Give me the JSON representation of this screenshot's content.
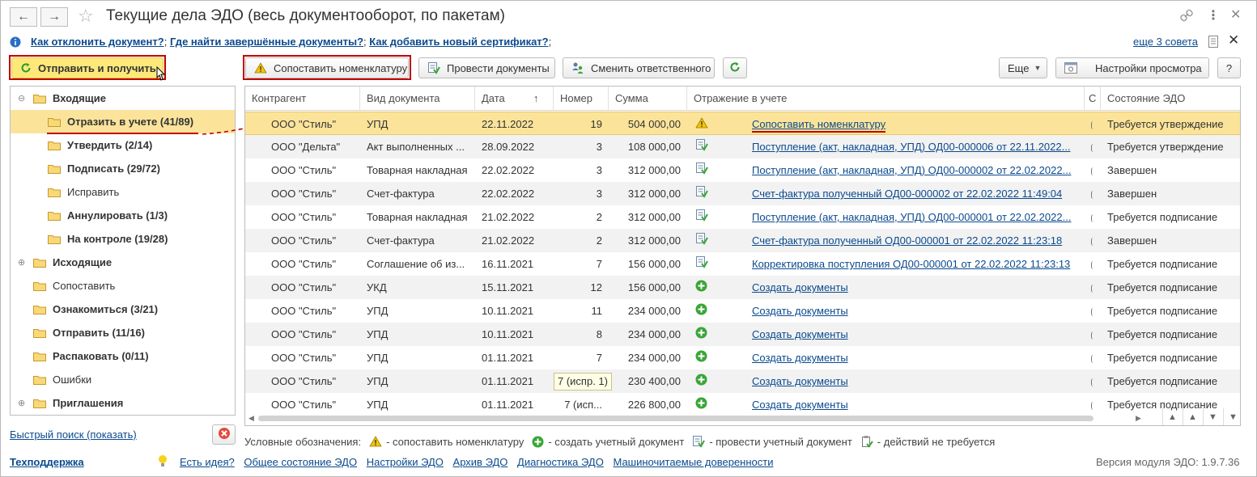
{
  "window": {
    "title": "Текущие дела ЭДО (весь документооборот, по пакетам)",
    "back_icon": "arrow-left-icon",
    "forward_icon": "arrow-right-icon",
    "favorite_icon": "star-icon"
  },
  "help": {
    "links": [
      "Как отклонить документ?",
      "Где найти завершённые документы?",
      "Как добавить новый сертификат?"
    ],
    "more_tips": "еще 3 совета"
  },
  "toolbar": {
    "send_receive": "Отправить и получить",
    "match_nomenclature": "Сопоставить номенклатуру",
    "post_documents": "Провести документы",
    "change_responsible": "Сменить ответственного",
    "more": "Еще",
    "view_settings": "Настройки просмотра",
    "help": "?"
  },
  "tree": [
    {
      "label": "Входящие",
      "bold": true,
      "level": 0,
      "expander": "⊖"
    },
    {
      "label": "Отразить в учете (41/89)",
      "bold": true,
      "level": 1,
      "selected": true
    },
    {
      "label": "Утвердить (2/14)",
      "bold": true,
      "level": 1
    },
    {
      "label": "Подписать (29/72)",
      "bold": true,
      "level": 1
    },
    {
      "label": "Исправить",
      "bold": false,
      "level": 1
    },
    {
      "label": "Аннулировать (1/3)",
      "bold": true,
      "level": 1
    },
    {
      "label": "На контроле (19/28)",
      "bold": true,
      "level": 1
    },
    {
      "label": "Исходящие",
      "bold": true,
      "level": 0,
      "expander": "⊕"
    },
    {
      "label": "Сопоставить",
      "bold": false,
      "level": 0
    },
    {
      "label": "Ознакомиться (3/21)",
      "bold": true,
      "level": 0
    },
    {
      "label": "Отправить (11/16)",
      "bold": true,
      "level": 0
    },
    {
      "label": "Распаковать (0/11)",
      "bold": true,
      "level": 0
    },
    {
      "label": "Ошибки",
      "bold": false,
      "level": 0
    },
    {
      "label": "Приглашения",
      "bold": true,
      "level": 0,
      "expander": "⊕"
    }
  ],
  "quick_search": "Быстрый поиск (показать)",
  "grid": {
    "columns": [
      "Контрагент",
      "Вид документа",
      "Дата",
      "Номер",
      "Сумма",
      "Отражение в учете",
      "С",
      "Состояние ЭДО"
    ],
    "sort_indicator": "↑",
    "rows": [
      {
        "counterparty": "ООО \"Стиль\"",
        "doc_type": "УПД",
        "date": "22.11.2022",
        "number": "19",
        "sum": "504 000,00",
        "icon": "warning",
        "accounting": "Сопоставить номенклатуру",
        "state": "Требуется утверждение",
        "selected": true
      },
      {
        "counterparty": "ООО \"Дельта\"",
        "doc_type": "Акт выполненных ...",
        "date": "28.09.2022",
        "number": "3",
        "sum": "108 000,00",
        "icon": "post",
        "accounting": "Поступление (акт, накладная, УПД) ОД00-000006 от 22.11.2022...",
        "state": "Требуется утверждение"
      },
      {
        "counterparty": "ООО \"Стиль\"",
        "doc_type": "Товарная накладная",
        "date": "22.02.2022",
        "number": "3",
        "sum": "312 000,00",
        "icon": "post",
        "accounting": "Поступление (акт, накладная, УПД) ОД00-000002 от 22.02.2022...",
        "state": "Завершен"
      },
      {
        "counterparty": "ООО \"Стиль\"",
        "doc_type": "Счет-фактура",
        "date": "22.02.2022",
        "number": "3",
        "sum": "312 000,00",
        "icon": "post",
        "accounting": "Счет-фактура полученный ОД00-000002 от 22.02.2022 11:49:04",
        "state": "Завершен"
      },
      {
        "counterparty": "ООО \"Стиль\"",
        "doc_type": "Товарная накладная",
        "date": "21.02.2022",
        "number": "2",
        "sum": "312 000,00",
        "icon": "post",
        "accounting": "Поступление (акт, накладная, УПД) ОД00-000001 от 22.02.2022...",
        "state": "Требуется подписание"
      },
      {
        "counterparty": "ООО \"Стиль\"",
        "doc_type": "Счет-фактура",
        "date": "21.02.2022",
        "number": "2",
        "sum": "312 000,00",
        "icon": "post",
        "accounting": "Счет-фактура полученный ОД00-000001 от 22.02.2022 11:23:18",
        "state": "Завершен"
      },
      {
        "counterparty": "ООО \"Стиль\"",
        "doc_type": "Соглашение об из...",
        "date": "16.11.2021",
        "number": "7",
        "sum": "156 000,00",
        "icon": "post",
        "accounting": "Корректировка поступления ОД00-000001 от 22.02.2022 11:23:13",
        "state": "Требуется подписание"
      },
      {
        "counterparty": "ООО \"Стиль\"",
        "doc_type": "УКД",
        "date": "15.11.2021",
        "number": "12",
        "sum": "156 000,00",
        "icon": "create",
        "accounting": "Создать документы",
        "state": "Требуется подписание"
      },
      {
        "counterparty": "ООО \"Стиль\"",
        "doc_type": "УПД",
        "date": "10.11.2021",
        "number": "11",
        "sum": "234 000,00",
        "icon": "create",
        "accounting": "Создать документы",
        "state": "Требуется подписание"
      },
      {
        "counterparty": "ООО \"Стиль\"",
        "doc_type": "УПД",
        "date": "10.11.2021",
        "number": "8",
        "sum": "234 000,00",
        "icon": "create",
        "accounting": "Создать документы",
        "state": "Требуется подписание"
      },
      {
        "counterparty": "ООО \"Стиль\"",
        "doc_type": "УПД",
        "date": "01.11.2021",
        "number": "7",
        "sum": "234 000,00",
        "icon": "create",
        "accounting": "Создать документы",
        "state": "Требуется подписание"
      },
      {
        "counterparty": "ООО \"Стиль\"",
        "doc_type": "УПД",
        "date": "01.11.2021",
        "number": "7 (испр. 1)",
        "sum": "230 400,00",
        "icon": "create",
        "accounting": "Создать документы",
        "state": "Требуется подписание",
        "tooltip": true
      },
      {
        "counterparty": "ООО \"Стиль\"",
        "doc_type": "УПД",
        "date": "01.11.2021",
        "number": "7 (исп...",
        "sum": "226 800,00",
        "icon": "create",
        "accounting": "Создать документы",
        "state": "Требуется подписание"
      }
    ]
  },
  "legend": {
    "label": "Условные обозначения:",
    "items": [
      "- сопоставить номенклатуру",
      "- создать учетный документ",
      "- провести учетный документ",
      "- действий не требуется"
    ]
  },
  "footer": {
    "support": "Техподдержка",
    "links": [
      "Есть идея?",
      "Общее состояние ЭДО",
      "Настройки ЭДО",
      "Архив ЭДО",
      "Диагностика ЭДО",
      "Машиночитаемые доверенности"
    ],
    "version": "Версия модуля ЭДО: 1.9.7.36"
  },
  "colors": {
    "link": "#0b4a8e",
    "selection": "#fbe49a",
    "highlight_button": "#fde97a",
    "annotation_red": "#c00000",
    "icon_green": "#3aa537"
  }
}
